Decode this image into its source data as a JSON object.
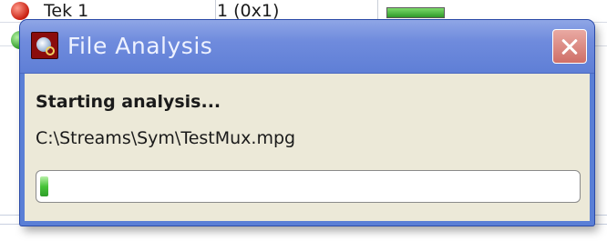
{
  "background_app": {
    "row1": {
      "name": "Tek 1",
      "value": "1 (0x1)"
    }
  },
  "dialog": {
    "title": "File Analysis",
    "icon": "file-analysis-icon",
    "close_icon": "close-icon",
    "status": "Starting analysis...",
    "file_path": "C:\\Streams\\Sym\\TestMux.mpg",
    "progress_fraction": 0.016
  },
  "colors": {
    "titlebar": "#6f8bdd",
    "client": "#ece9d8",
    "close_button": "#d8807a",
    "progress_fill": "#46c338"
  }
}
